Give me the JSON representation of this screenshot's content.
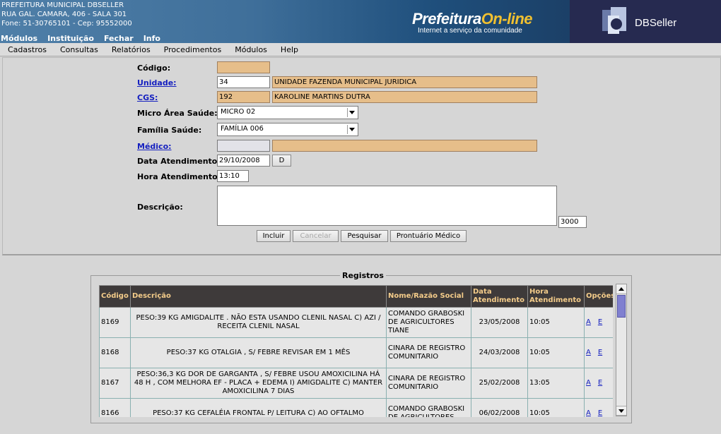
{
  "header": {
    "info_line1": "PREFEITURA MUNICIPAL DBSELLER",
    "info_line2": "RUA GAL. CAMARA, 406 - SALA 301",
    "info_line3": "Fone: 51-30765101  -  Cep: 95552000",
    "top_menu": [
      "Módulos",
      "Instituição",
      "Fechar",
      "Info"
    ],
    "brand_main": "Prefeitura",
    "brand_online": "On-line",
    "brand_sub": "Internet a serviço da comunidade",
    "db_logo_text": "DBSeller"
  },
  "menubar": [
    "Cadastros",
    "Consultas",
    "Relatórios",
    "Procedimentos",
    "Módulos",
    "Help"
  ],
  "form": {
    "codigo": {
      "label": "Código:",
      "value": ""
    },
    "unidade": {
      "label": "Unidade:",
      "code": "34",
      "name": "UNIDADE FAZENDA MUNICIPAL JURIDICA"
    },
    "cgs": {
      "label": "CGS:",
      "code": "192",
      "name": "KAROLINE MARTINS DUTRA"
    },
    "micro_area": {
      "label": "Micro Área Saúde:",
      "value": "MICRO 02"
    },
    "familia": {
      "label": "Família Saúde:",
      "value": "FAMÍLIA 006"
    },
    "medico": {
      "label": "Médico:",
      "code": "",
      "name": ""
    },
    "data": {
      "label": "Data Atendimento:",
      "value": "29/10/2008",
      "btn": "D"
    },
    "hora": {
      "label": "Hora Atendimento:",
      "value": "13:10"
    },
    "descricao": {
      "label": "Descrição:",
      "counter": "3000"
    },
    "buttons": {
      "incluir": "Incluir",
      "cancelar": "Cancelar",
      "pesquisar": "Pesquisar",
      "prontuario": "Prontuário Médico"
    }
  },
  "registros": {
    "legend": "Registros",
    "columns": [
      "Código",
      "Descrição",
      "Nome/Razão Social",
      "Data Atendimento",
      "Hora Atendimento",
      "Opções"
    ],
    "rows": [
      {
        "codigo": "8169",
        "descricao": "PESO:39 KG AMIGDALITE . NÃO ESTA USANDO CLENIL NASAL C) AZI / RECEITA CLENIL NASAL",
        "nome": "COMANDO GRABOSKI DE AGRICULTORES TIANE",
        "data": "23/05/2008",
        "hora": "10:05",
        "opt_a": "A",
        "opt_e": "E"
      },
      {
        "codigo": "8168",
        "descricao": "PESO:37 KG OTALGIA , S/ FEBRE REVISAR EM 1 MÊS",
        "nome": "CINARA DE REGISTRO COMUNITARIO",
        "data": "24/03/2008",
        "hora": "10:05",
        "opt_a": "A",
        "opt_e": "E"
      },
      {
        "codigo": "8167",
        "descricao": "PESO:36,3 KG DOR DE GARGANTA , S/ FEBRE USOU AMOXICILINA HÁ 48 H , COM MELHORA EF - PLACA + EDEMA I) AMIGDALITE C) MANTER AMOXICILINA 7 DIAS",
        "nome": "CINARA DE REGISTRO COMUNITARIO",
        "data": "25/02/2008",
        "hora": "13:05",
        "opt_a": "A",
        "opt_e": "E"
      },
      {
        "codigo": "8166",
        "descricao": "PESO:37 KG CEFALÉIA FRONTAL P/ LEITURA C) AO OFTALMO",
        "nome": "COMANDO GRABOSKI DE AGRICULTORES",
        "data": "06/02/2008",
        "hora": "10:05",
        "opt_a": "A",
        "opt_e": "E"
      }
    ]
  }
}
